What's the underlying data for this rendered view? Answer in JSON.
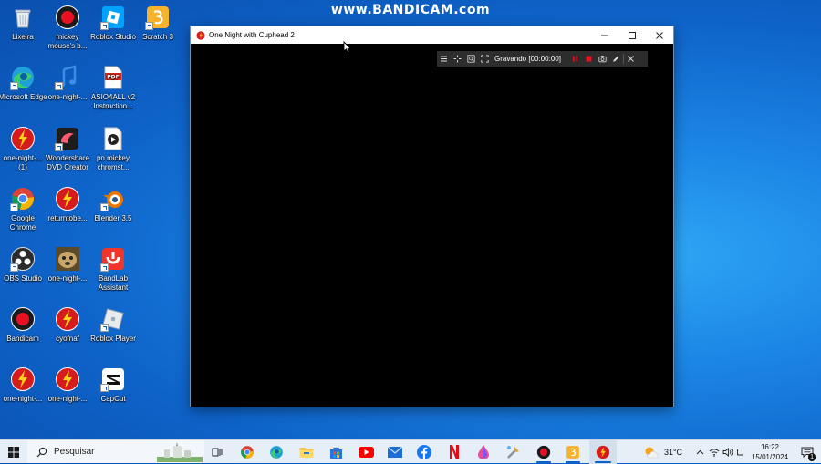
{
  "watermark": "www.BANDICAM.com",
  "desktop_icons": [
    {
      "label": "Lixeira"
    },
    {
      "label": "mickey mouse's b..."
    },
    {
      "label": "Roblox Studio"
    },
    {
      "label": "Scratch 3"
    },
    {
      "label": "Microsoft Edge"
    },
    {
      "label": "one-night-..."
    },
    {
      "label": "ASIO4ALL v2 Instruction..."
    },
    {
      "label": "one-night-... (1)"
    },
    {
      "label": "Wondershare DVD Creator"
    },
    {
      "label": "pn mickey chromst..."
    },
    {
      "label": "Google Chrome"
    },
    {
      "label": "returntobe..."
    },
    {
      "label": "Blender 3.5"
    },
    {
      "label": "OBS Studio"
    },
    {
      "label": "one-night-..."
    },
    {
      "label": "BandLab Assistant"
    },
    {
      "label": "Bandicam"
    },
    {
      "label": "cyofnaf"
    },
    {
      "label": "Roblox Player"
    },
    {
      "label": "one-night-..."
    },
    {
      "label": "one-night-..."
    },
    {
      "label": "CapCut"
    }
  ],
  "window": {
    "title": "One Night with Cuphead 2"
  },
  "bandicam": {
    "status": "Gravando [00:00:00]"
  },
  "taskbar": {
    "search_placeholder": "Pesquisar",
    "weather": "31°C",
    "time": "16:22",
    "date": "15/01/2024",
    "notification_count": "1"
  },
  "colors": {
    "accent": "#0a64c8",
    "record_red": "#e81123",
    "desktop_blue": "#1c86e6"
  }
}
